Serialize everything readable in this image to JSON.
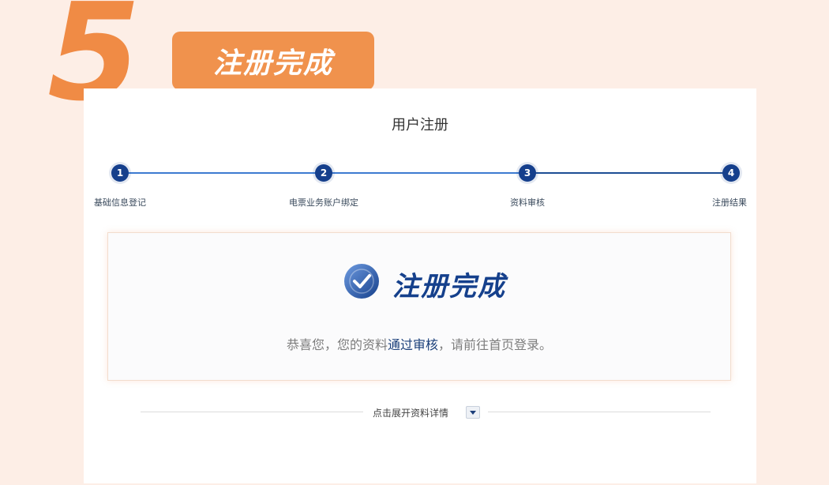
{
  "banner": {
    "step_number": "5",
    "step_title": "注册完成"
  },
  "card": {
    "title": "用户注册"
  },
  "steps": [
    {
      "num": "1",
      "label": "基础信息登记"
    },
    {
      "num": "2",
      "label": "电票业务账户绑定"
    },
    {
      "num": "3",
      "label": "资料审核"
    },
    {
      "num": "4",
      "label": "注册结果"
    }
  ],
  "result": {
    "title": "注册完成",
    "message_prefix": "恭喜您，您的资料",
    "message_highlight": "通过审核",
    "message_suffix": "，请前往首页登录。"
  },
  "expand": {
    "label": "点击展开资料详情"
  },
  "colors": {
    "accent_orange": "#f08b45",
    "step_blue": "#153f8c",
    "line_blue": "#3d7bd1"
  }
}
